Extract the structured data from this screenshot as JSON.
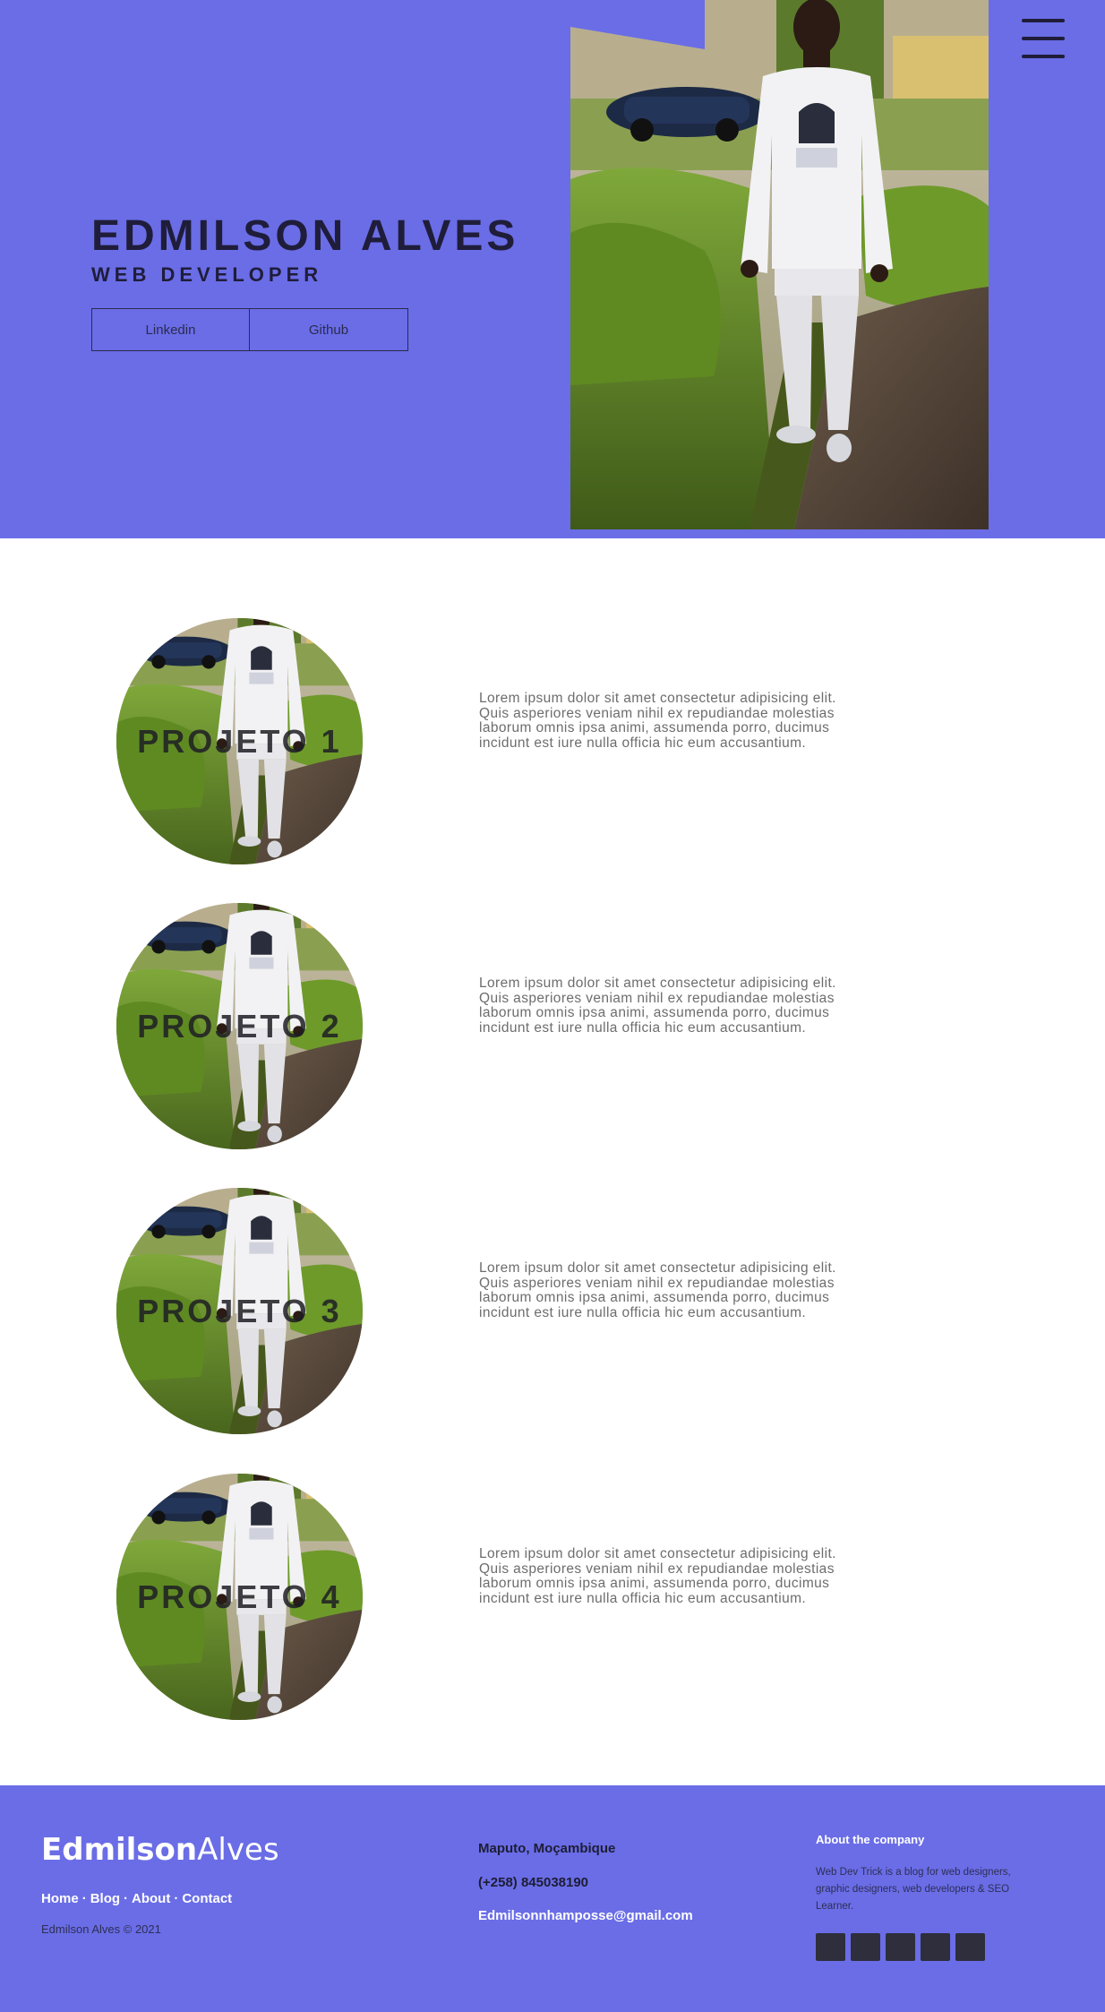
{
  "hero": {
    "name": "EDMILSON ALVES",
    "role": "WEB DEVELOPER",
    "buttons": {
      "linkedin": "Linkedin",
      "github": "Github"
    },
    "background_color": "#6a6de6",
    "menu_icon": "hamburger-menu-icon"
  },
  "projects": [
    {
      "title": "PROJETO 1",
      "description": "Lorem ipsum dolor sit amet consectetur adipisicing elit. Quis asperiores veniam nihil ex repudiandae molestias laborum omnis ipsa animi, assumenda porro, ducimus incidunt est iure nulla officia hic eum accusantium."
    },
    {
      "title": "PROJETO 2",
      "description": "Lorem ipsum dolor sit amet consectetur adipisicing elit. Quis asperiores veniam nihil ex repudiandae molestias laborum omnis ipsa animi, assumenda porro, ducimus incidunt est iure nulla officia hic eum accusantium."
    },
    {
      "title": "PROJETO 3",
      "description": "Lorem ipsum dolor sit amet consectetur adipisicing elit. Quis asperiores veniam nihil ex repudiandae molestias laborum omnis ipsa animi, assumenda porro, ducimus incidunt est iure nulla officia hic eum accusantium."
    },
    {
      "title": "PROJETO 4",
      "description": "Lorem ipsum dolor sit amet consectetur adipisicing elit. Quis asperiores veniam nihil ex repudiandae molestias laborum omnis ipsa animi, assumenda porro, ducimus incidunt est iure nulla officia hic eum accusantium."
    }
  ],
  "footer": {
    "logo_first": "Edmilson",
    "logo_second": "Alves",
    "nav": {
      "home": "Home",
      "blog": "Blog",
      "about": "About",
      "contact": "Contact",
      "separator": "·"
    },
    "copyright": "Edmilson Alves © 2021",
    "location": "Maputo, Moçambique",
    "phone": "(+258) 845038190",
    "email": "Edmilsonnhamposse@gmail.com",
    "about_title": "About the company",
    "about_text": "Web Dev Trick is a blog for web designers, graphic designers, web developers & SEO Learner.",
    "social_icons": [
      "social-icon-1",
      "social-icon-2",
      "social-icon-3",
      "social-icon-4",
      "social-icon-5"
    ]
  }
}
